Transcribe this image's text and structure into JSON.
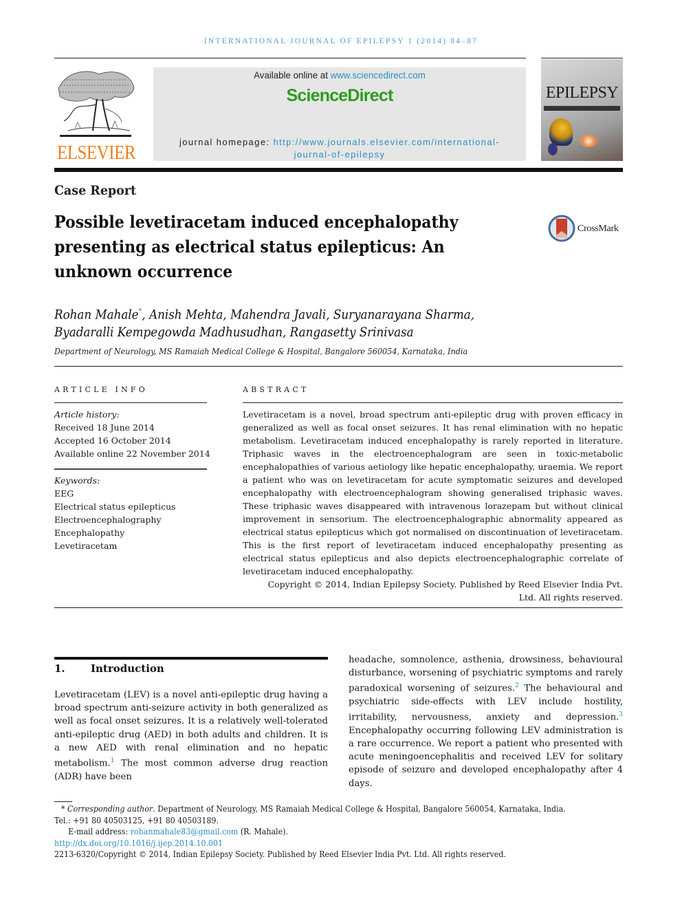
{
  "running_head": "International Journal of Epilepsy 1 (2014) 84–87",
  "masthead": {
    "publisher_logo_text": "ELSEVIER",
    "available_online_prefix": "Available online at",
    "available_online_link": "www.sciencedirect.com",
    "platform_name": "ScienceDirect",
    "homepage_label": "journal homepage:",
    "homepage_link_line1": "http://www.journals.elsevier.com/international-",
    "homepage_link_line2": "journal-of-epilepsy",
    "cover_title": "EPILEPSY"
  },
  "article": {
    "type": "Case Report",
    "title": "Possible levetiracetam induced encephalopathy presenting as electrical status epilepticus: An unknown occurrence",
    "crossmark_label": "CrossMark",
    "authors_line1_first": "Rohan Mahale",
    "corresponding_mark": "*",
    "authors_line1_rest": ", Anish Mehta, Mahendra Javali, Suryanarayana Sharma,",
    "authors_line2": "Byadaralli Kempegowda Madhusudhan, Rangasetty Srinivasa",
    "affiliation": "Department of Neurology, MS Ramaiah Medical College & Hospital, Bangalore 560054, Karnataka, India"
  },
  "article_info": {
    "heading": "ARTICLE INFO",
    "history_label": "Article history:",
    "history": [
      "Received 18 June 2014",
      "Accepted 16 October 2014",
      "Available online 22 November 2014"
    ],
    "keywords_label": "Keywords:",
    "keywords": [
      "EEG",
      "Electrical status epilepticus",
      "Electroencephalography",
      "Encephalopathy",
      "Levetiracetam"
    ]
  },
  "abstract": {
    "heading": "ABSTRACT",
    "text": "Levetiracetam is a novel, broad spectrum anti-epileptic drug with proven efficacy in generalized as well as focal onset seizures. It has renal elimination with no hepatic metabolism. Levetiracetam induced encephalopathy is rarely reported in literature. Tri­phasic waves in the electroencephalogram are seen in toxic-metabolic encephalopathies of various aetiology like hepatic encephalopathy, uraemia. We report a patient who was on levetiracetam for acute symptomatic seizures and developed encephalopathy with elec­troencephalogram showing generalised triphasic waves. These triphasic waves dis­appeared with intravenous lorazepam but without clinical improvement in sensorium. The electroencephalographic abnormality appeared as electrical status epilepticus which got normalised on discontinuation of levetiracetam. This is the first report of levetiracetam induced encephalopathy presenting as electrical status epilepticus and also depicts elec­troencephalographic correlate of levetiracetam induced encephalopathy.",
    "copyright": "Copyright © 2014, Indian Epilepsy Society. Published by Reed Elsevier India Pvt. Ltd. All rights reserved."
  },
  "introduction": {
    "number": "1.",
    "heading": "Introduction",
    "left_part1": "Levetiracetam (LEV) is a novel anti-epileptic drug having a broad spectrum anti-seizure activity in both generalized as well as focal onset seizures. It is a relatively well-tolerated anti-epileptic drug (AED) in both adults and children. It is a new AED with renal elimination and no hepatic metabolism.",
    "ref1": "1",
    "left_part2": " The most common adverse drug reaction (ADR) have been",
    "right_part1": "headache, somnolence, asthenia, drowsiness, behavioural disturbance, worsening of psychiatric symptoms and rarely paradoxical worsening of seizures.",
    "ref2": "2",
    "right_part2": " The behavioural and psychiatric side-effects with LEV include hostility, irritability, nervousness, anxiety and depression.",
    "ref3": "3",
    "right_part3": " Encephalopathy occurring following LEV administration is a rare occurrence. We report a patient who presented with acute meningoencephalitis and received LEV for solitary episode of seizure and developed encephalopathy after 4 days."
  },
  "footnotes": {
    "corresponding_mark": "*",
    "corresponding_label": "Corresponding author",
    "corresponding_text": ". Department of Neurology, MS Ramaiah Medical College & Hospital, Bangalore 560054, Karnataka, India.",
    "tel": "Tel.: +91 80 40503125, +91 80 40503189.",
    "email_label": "E-mail address:",
    "email": "rohanmahale83@gmail.com",
    "email_suffix": " (R. Mahale).",
    "doi": "http://dx.doi.org/10.1016/j.ijep.2014.10.001",
    "issn_copyright": "2213-6320/Copyright © 2014, Indian Epilepsy Society. Published by Reed Elsevier India Pvt. Ltd. All rights reserved."
  },
  "colors": {
    "link": "#2a8fc1",
    "running_head": "#4fa3c8",
    "sciencedirect_green": "#2c9c1e",
    "elsevier_orange": "#f07e1b",
    "masthead_box": "#e6e6e6"
  }
}
